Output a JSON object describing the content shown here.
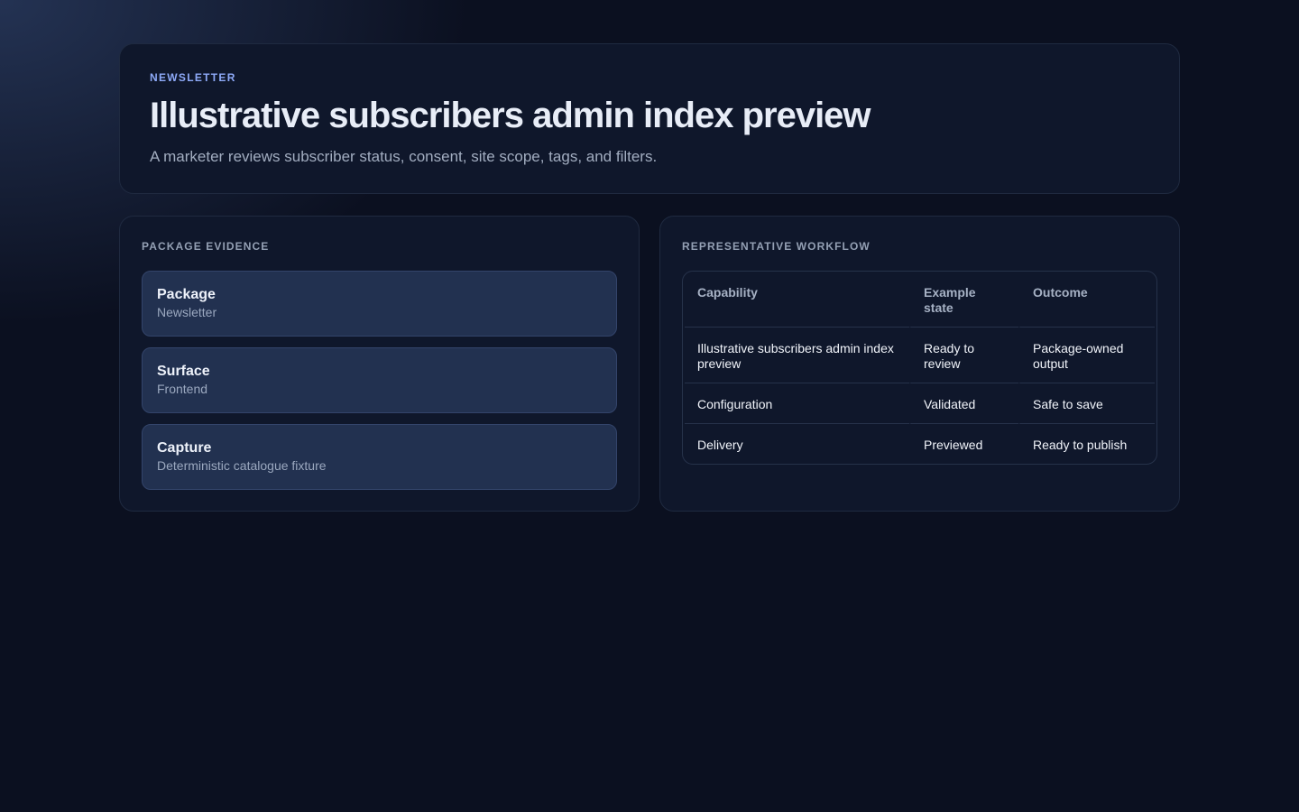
{
  "header": {
    "eyebrow": "NEWSLETTER",
    "title": "Illustrative subscribers admin index preview",
    "subtitle": "A marketer reviews subscriber status, consent, site scope, tags, and filters."
  },
  "evidence": {
    "heading": "PACKAGE EVIDENCE",
    "items": [
      {
        "label": "Package",
        "value": "Newsletter"
      },
      {
        "label": "Surface",
        "value": "Frontend"
      },
      {
        "label": "Capture",
        "value": "Deterministic catalogue fixture"
      }
    ]
  },
  "workflow": {
    "heading": "REPRESENTATIVE WORKFLOW",
    "columns": [
      "Capability",
      "Example state",
      "Outcome"
    ],
    "rows": [
      [
        "Illustrative subscribers admin index preview",
        "Ready to review",
        "Package-owned output"
      ],
      [
        "Configuration",
        "Validated",
        "Safe to save"
      ],
      [
        "Delivery",
        "Previewed",
        "Ready to publish"
      ]
    ]
  }
}
